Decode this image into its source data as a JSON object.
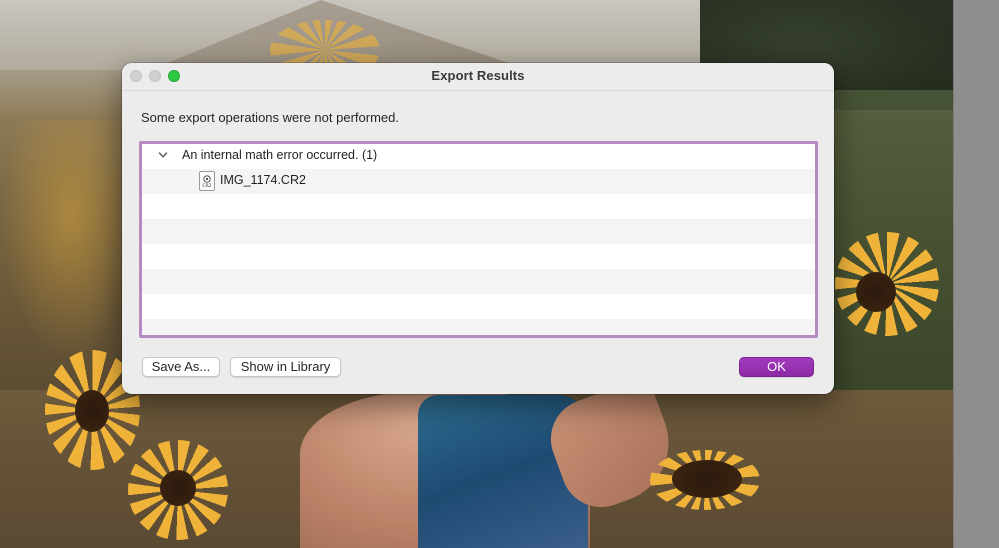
{
  "window": {
    "title": "Export Results"
  },
  "dialog": {
    "message": "Some export operations were not performed.",
    "results": {
      "groups": [
        {
          "label": "An internal math error occurred. (1)",
          "expanded": true,
          "items": [
            {
              "file_name": "IMG_1174.CR2",
              "file_type": "CR2"
            }
          ]
        }
      ]
    },
    "buttons": {
      "save_as": "Save As...",
      "show_in_library": "Show in Library",
      "ok": "OK"
    }
  },
  "colors": {
    "accent": "#9633b0",
    "list_border": "#b58bc4",
    "zoom_button": "#2dc840"
  },
  "icons": {
    "disclosure": "chevron-down-icon",
    "file": "raw-file-icon"
  }
}
